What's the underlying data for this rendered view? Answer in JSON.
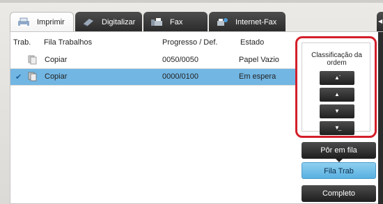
{
  "tabs": [
    {
      "label": "Imprimir",
      "icon": "printer-icon",
      "active": true
    },
    {
      "label": "Digitalizar",
      "icon": "scanner-icon",
      "active": false
    },
    {
      "label": "Fax",
      "icon": "fax-icon",
      "active": false
    },
    {
      "label": "Internet-Fax",
      "icon": "internet-fax-icon",
      "active": false
    }
  ],
  "list": {
    "headers": {
      "trab": "Trab.",
      "queue": "Fila Trabalhos",
      "progress": "Progresso / Def.",
      "status": "Estado"
    },
    "rows": [
      {
        "name": "Copiar",
        "progress": "0050/0050",
        "status": "Papel Vazio",
        "selected": false
      },
      {
        "name": "Copiar",
        "progress": "0000/0100",
        "status": "Em espera",
        "selected": true
      }
    ]
  },
  "sort": {
    "label": "Classificação da ordem",
    "buttons": [
      "move-top",
      "move-up",
      "move-down",
      "move-bottom"
    ]
  },
  "modes": {
    "spool": "Pôr em fila",
    "queue": "Fila Trab",
    "complete": "Completo"
  },
  "colors": {
    "selected_row": "#72b6e3",
    "highlight_border": "#d31f2a",
    "active_mode": "#58b0e0"
  }
}
